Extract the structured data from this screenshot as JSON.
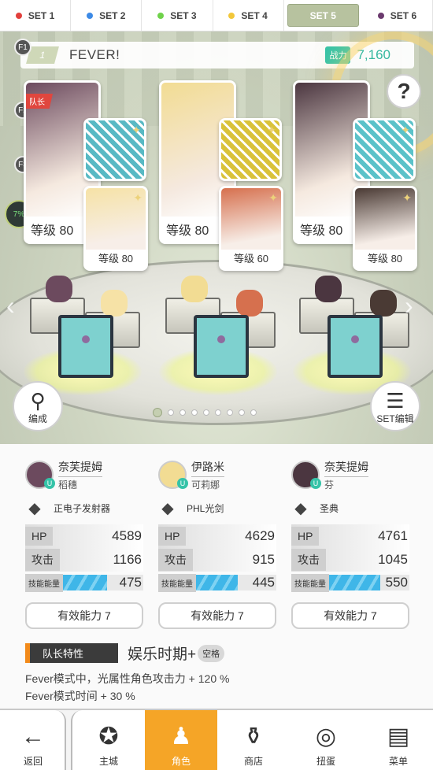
{
  "set_tabs": [
    {
      "label": "SET 1",
      "dot_color": "#e2403c",
      "active": false
    },
    {
      "label": "SET 2",
      "dot_color": "#3c8ae6",
      "active": false
    },
    {
      "label": "SET 3",
      "dot_color": "#6fd24a",
      "active": false
    },
    {
      "label": "SET 4",
      "dot_color": "#f2c73a",
      "active": false
    },
    {
      "label": "SET 5",
      "dot_color": "",
      "active": true
    },
    {
      "label": "SET 6",
      "dot_color": "#6b3a6e",
      "active": false
    }
  ],
  "floor_labels": [
    "F1",
    "F2",
    "F3"
  ],
  "fever": {
    "number": "1",
    "text": "FEVER!"
  },
  "power": {
    "label": "战力",
    "value": "7,160"
  },
  "help_label": "?",
  "side_tag": "7%",
  "squads": [
    {
      "leader_tag": "队长",
      "leader_level": "等级 80",
      "sub_level": "等级 80",
      "leader_color": "#6c4a5e",
      "weapon_bg": "#58b9c4",
      "sub_color": "#f6e2a6"
    },
    {
      "leader_tag": "",
      "leader_level": "等级 80",
      "sub_level": "等级 60",
      "leader_color": "#f2dc93",
      "weapon_bg": "#d9c23a",
      "sub_color": "#d6704e"
    },
    {
      "leader_tag": "",
      "leader_level": "等级 80",
      "sub_level": "等级 80",
      "leader_color": "#4b3640",
      "weapon_bg": "#5bc2c9",
      "sub_color": "#4a3a34"
    }
  ],
  "pager": {
    "count": 9,
    "active": 0
  },
  "buttons": {
    "formation": "编成",
    "set_edit": "SET编辑"
  },
  "characters": [
    {
      "name": "奈芙提姆",
      "sub": "稻穗",
      "weapon": "正电子发射器",
      "hp": "4589",
      "atk": "1166",
      "energy": "475",
      "energy_ratio": 0.55,
      "ability": "有效能力 7",
      "avatar_color": "#6c4a5e"
    },
    {
      "name": "伊路米",
      "sub": "可莉娜",
      "weapon": "PHL光剑",
      "hp": "4629",
      "atk": "915",
      "energy": "445",
      "energy_ratio": 0.52,
      "ability": "有效能力 7",
      "avatar_color": "#f2dc93"
    },
    {
      "name": "奈芙提姆",
      "sub": "芬",
      "weapon": "圣典",
      "hp": "4761",
      "atk": "1045",
      "energy": "550",
      "energy_ratio": 0.64,
      "ability": "有效能力 7",
      "avatar_color": "#4b3640"
    }
  ],
  "stat_labels": {
    "hp": "HP",
    "atk": "攻击",
    "energy": "技能能量",
    "u_badge": "U"
  },
  "leader_trait": {
    "label": "队长特性",
    "name": "娱乐时期+",
    "key": "空格",
    "desc1": "Fever模式中，光属性角色攻击力 + 120 %",
    "desc2": "Fever模式时间 + 30 %"
  },
  "nav": {
    "back": "返回",
    "items": [
      {
        "label": "主城",
        "icon": "castle-icon",
        "active": false
      },
      {
        "label": "角色",
        "icon": "character-icon",
        "active": true
      },
      {
        "label": "商店",
        "icon": "shop-icon",
        "active": false
      },
      {
        "label": "扭蛋",
        "icon": "gacha-icon",
        "active": false
      },
      {
        "label": "菜单",
        "icon": "menu-icon",
        "active": false
      }
    ]
  }
}
